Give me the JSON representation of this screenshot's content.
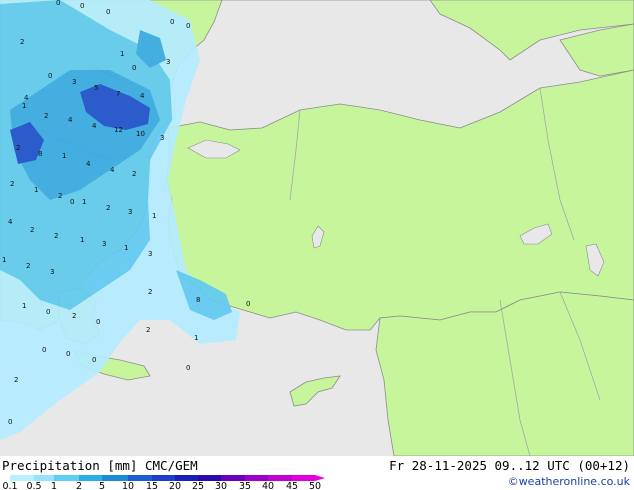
{
  "footer": {
    "title": "Precipitation [mm]  CMC/GEM",
    "timestamp": "Fr 28-11-2025 09..12 UTC (00+12)",
    "credit": "©weatheronline.co.uk"
  },
  "legend": {
    "ticks": [
      "0.1",
      "0.5",
      "1",
      "2",
      "5",
      "10",
      "15",
      "20",
      "25",
      "30",
      "35",
      "40",
      "45",
      "50"
    ],
    "colors": [
      "#b8f0ff",
      "#96e3fa",
      "#5ccff2",
      "#2aaee6",
      "#1b8bd8",
      "#1c5fd0",
      "#1f3ec8",
      "#1a1fb8",
      "#2a0aa8",
      "#6a00b8",
      "#9a00c8",
      "#c000d0",
      "#e000d8"
    ]
  },
  "map": {
    "colors": {
      "land": "#c6f59c",
      "sea": "#e8e8e8",
      "border": "#8c8c8c",
      "precip_light": "#b4ecff",
      "precip_mid": "#62c9f2",
      "precip_heavy": "#1f4fd0"
    },
    "labels": [
      {
        "t": "0"
      },
      {
        "t": "0"
      },
      {
        "t": "0"
      },
      {
        "t": "0"
      },
      {
        "t": "0"
      },
      {
        "t": "2"
      },
      {
        "t": "1"
      },
      {
        "t": "3"
      },
      {
        "t": "0"
      },
      {
        "t": "3"
      },
      {
        "t": "0"
      },
      {
        "t": "5"
      },
      {
        "t": "4"
      },
      {
        "t": "7"
      },
      {
        "t": "4"
      },
      {
        "t": "1"
      },
      {
        "t": "2"
      },
      {
        "t": "4"
      },
      {
        "t": "4"
      },
      {
        "t": "12"
      },
      {
        "t": "10"
      },
      {
        "t": "3"
      },
      {
        "t": "2"
      },
      {
        "t": "8"
      },
      {
        "t": "1"
      },
      {
        "t": "4"
      },
      {
        "t": "4"
      },
      {
        "t": "2"
      },
      {
        "t": "2"
      },
      {
        "t": "1"
      },
      {
        "t": "2"
      },
      {
        "t": "1"
      },
      {
        "t": "0"
      },
      {
        "t": "2"
      },
      {
        "t": "3"
      },
      {
        "t": "1"
      },
      {
        "t": "4"
      },
      {
        "t": "2"
      },
      {
        "t": "2"
      },
      {
        "t": "1"
      },
      {
        "t": "3"
      },
      {
        "t": "1"
      },
      {
        "t": "3"
      },
      {
        "t": "2"
      },
      {
        "t": "3"
      },
      {
        "t": "1"
      },
      {
        "t": "2"
      },
      {
        "t": "2"
      },
      {
        "t": "8"
      },
      {
        "t": "0"
      },
      {
        "t": "1"
      },
      {
        "t": "0"
      },
      {
        "t": "2"
      },
      {
        "t": "0"
      },
      {
        "t": "0"
      },
      {
        "t": "1"
      },
      {
        "t": "0"
      },
      {
        "t": "0"
      },
      {
        "t": "2"
      },
      {
        "t": "0"
      },
      {
        "t": "0"
      }
    ]
  }
}
